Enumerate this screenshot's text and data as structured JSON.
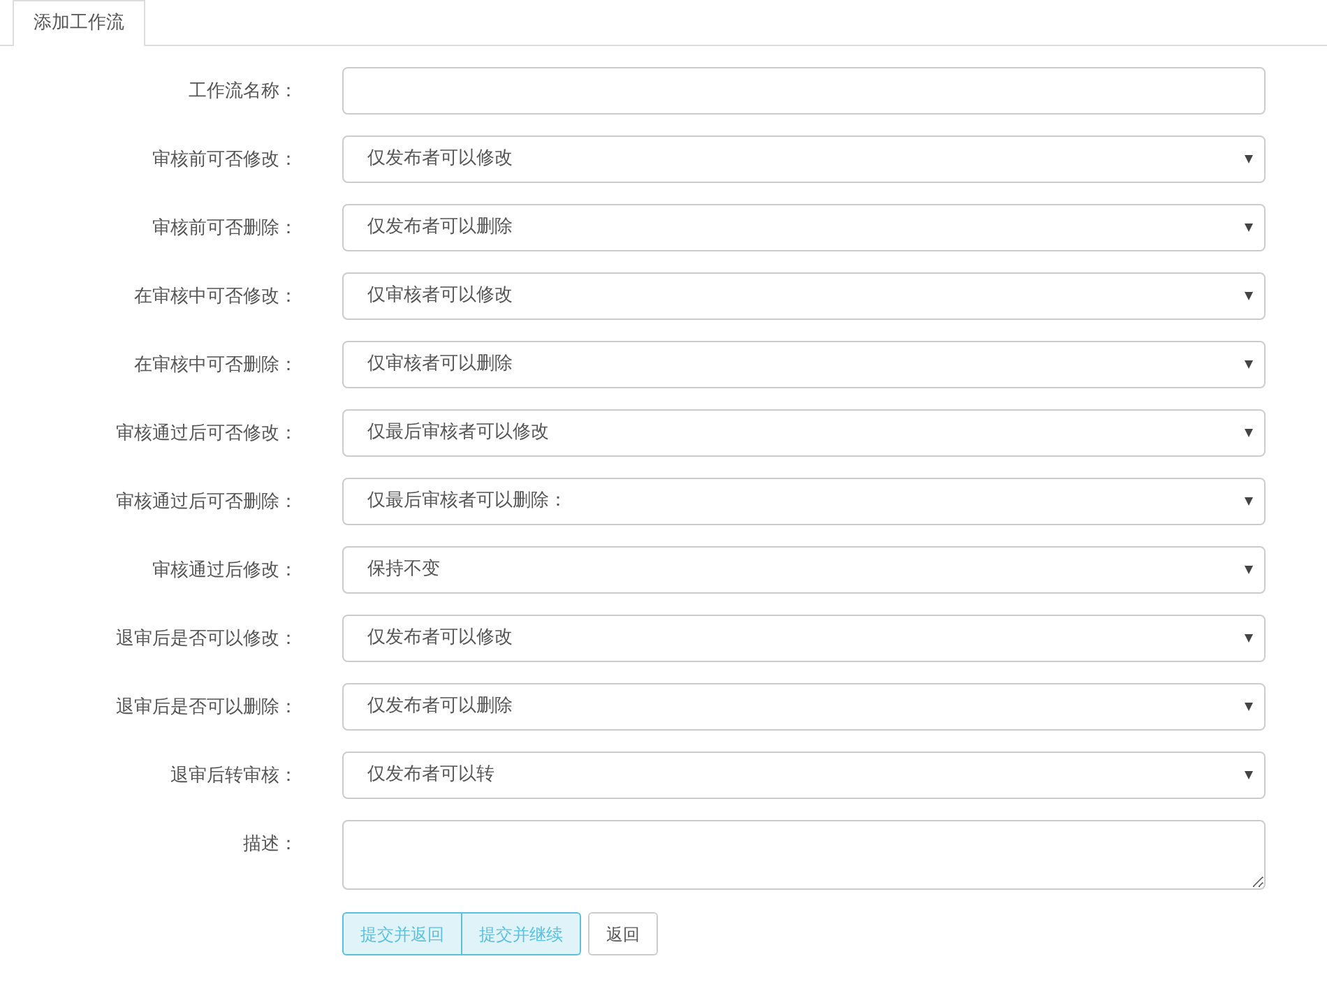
{
  "tabs": [
    {
      "label": "添加工作流",
      "selected": true
    }
  ],
  "fields": [
    {
      "label": "工作流名称：",
      "kind": "text"
    },
    {
      "label": "审核前可否修改：",
      "kind": "select",
      "value": "仅发布者可以修改"
    },
    {
      "label": "审核前可否删除：",
      "kind": "select",
      "value": "仅发布者可以删除"
    },
    {
      "label": "在审核中可否修改：",
      "kind": "select",
      "value": "仅审核者可以修改"
    },
    {
      "label": "在审核中可否删除：",
      "kind": "select",
      "value": "仅审核者可以删除"
    },
    {
      "label": "审核通过后可否修改：",
      "kind": "select",
      "value": "仅最后审核者可以修改"
    },
    {
      "label": "审核通过后可否删除：",
      "kind": "select",
      "value": "仅最后审核者可以删除："
    },
    {
      "label": "审核通过后修改：",
      "kind": "select",
      "value": "保持不变"
    },
    {
      "label": "退审后是否可以修改：",
      "kind": "select",
      "value": "仅发布者可以修改"
    },
    {
      "label": "退审后是否可以删除：",
      "kind": "select",
      "value": "仅发布者可以删除"
    },
    {
      "label": "退审后转审核：",
      "kind": "select",
      "value": "仅发布者可以转"
    },
    {
      "label": "描述：",
      "kind": "textarea"
    }
  ],
  "buttons": [
    {
      "label": "提交并返回",
      "kind": "primary"
    },
    {
      "label": "提交并继续",
      "kind": "primary"
    },
    {
      "label": "返回",
      "kind": "default"
    }
  ]
}
